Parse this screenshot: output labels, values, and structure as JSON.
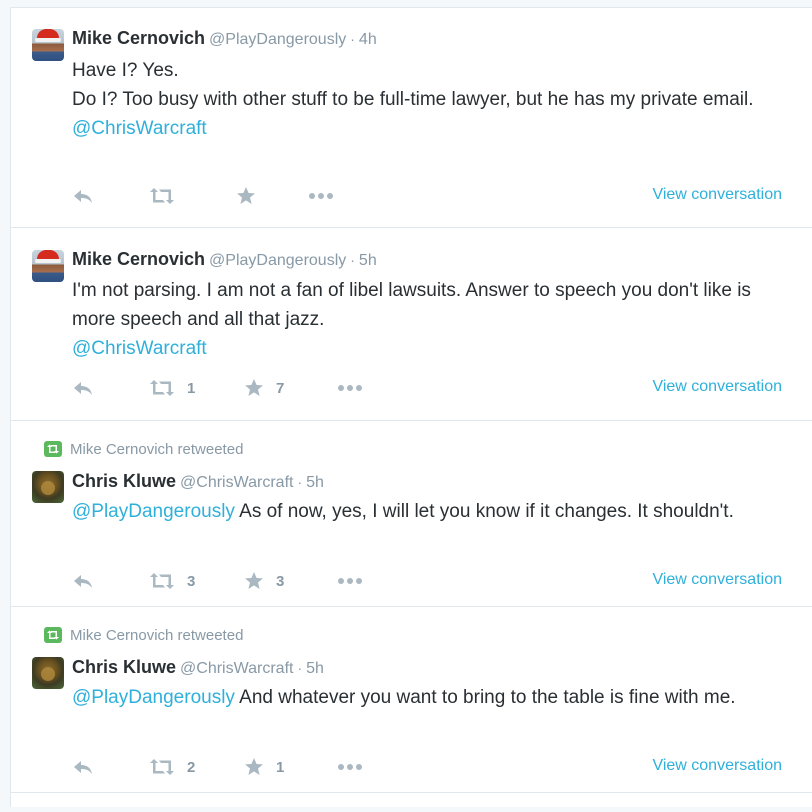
{
  "tweets": [
    {
      "name": "Mike Cernovich",
      "handle": "@PlayDangerously",
      "time": "4h",
      "lines": [
        "Have I? Yes.",
        "Do I? Too busy with other stuff to be full-time lawyer, but he has my private email.",
        "@ChrisWarcraft"
      ],
      "retweets": "",
      "likes": "",
      "view_conversation": "View conversation"
    },
    {
      "name": "Mike Cernovich",
      "handle": "@PlayDangerously",
      "time": "5h",
      "body": "I'm not parsing. I am not a fan of libel lawsuits. Answer to speech you don't like is more speech and all that jazz.",
      "mention": "@ChrisWarcraft",
      "retweets": "1",
      "likes": "7",
      "view_conversation": "View conversation"
    },
    {
      "retweeted_by": "Mike Cernovich retweeted",
      "name": "Chris Kluwe",
      "handle": "@ChrisWarcraft",
      "time": "5h",
      "mention": "@PlayDangerously",
      "body": " As of now, yes, I will let you know if it changes. It shouldn't.",
      "retweets": "3",
      "likes": "3",
      "view_conversation": "View conversation"
    },
    {
      "retweeted_by": "Mike Cernovich retweeted",
      "name": "Chris Kluwe",
      "handle": "@ChrisWarcraft",
      "time": "5h",
      "mention": "@PlayDangerously",
      "body": " And whatever you want to bring to the table is fine with me.",
      "retweets": "2",
      "likes": "1",
      "view_conversation": "View conversation"
    }
  ],
  "colors": {
    "link": "#2fb0db",
    "muted": "#8899a6",
    "retweet_badge": "#5cb85c"
  },
  "icons": [
    "reply-icon",
    "retweet-icon",
    "favorite-icon",
    "more-icon",
    "retweeted-icon"
  ]
}
